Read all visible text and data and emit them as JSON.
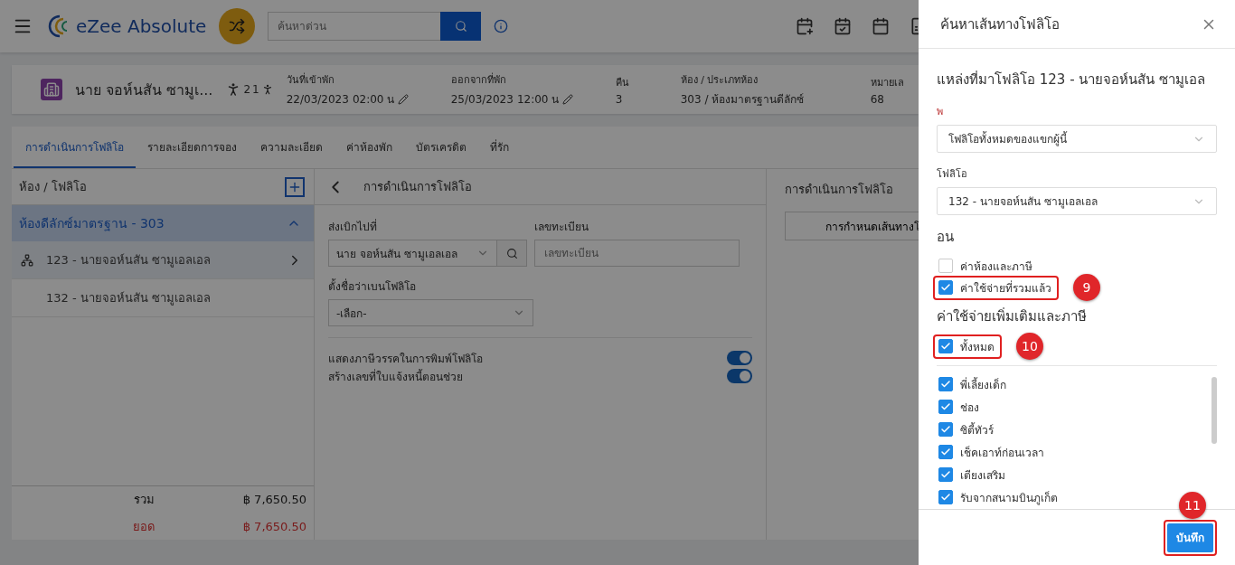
{
  "topbar": {
    "logo": "eZee Absolute",
    "search": {
      "placeholder": "ค้นหาด่วน"
    }
  },
  "guest": {
    "name": "นาย จอห์นสัน ซามูเ...",
    "adults": "2",
    "children": "1",
    "fields": [
      {
        "label": "วันที่เข้าพัก",
        "value": "22/03/2023",
        "time": "02:00 น",
        "editable": true
      },
      {
        "label": "ออกจากที่พัก",
        "value": "25/03/2023",
        "time": "12:00 น",
        "editable": true
      },
      {
        "label": "คืน",
        "value": "3",
        "editable": false
      },
      {
        "label": "ห้อง / ประเภทห้อง",
        "value": "303 / ห้องมาตรฐานดีลักซ์",
        "editable": false
      },
      {
        "label": "หมายเล",
        "value": "68",
        "editable": false
      }
    ]
  },
  "tabs": [
    {
      "label": "การดำเนินการโฟลิโอ",
      "selected": true
    },
    {
      "label": "รายละเอียดการจอง",
      "selected": false
    },
    {
      "label": "ความละเอียด",
      "selected": false
    },
    {
      "label": "ค่าห้องพัก",
      "selected": false
    },
    {
      "label": "บัตรเครดิต",
      "selected": false
    },
    {
      "label": "ที่รัก",
      "selected": false
    }
  ],
  "folio_list": {
    "title": "ห้อง / โฟลิโอ",
    "group": {
      "label": "ห้องดีลักซ์มาตรฐาน - 303",
      "expanded": true
    },
    "items": [
      {
        "label": "123 - นายจอห์นสัน ซามูเอลเอล",
        "selected": true
      },
      {
        "label": "132 - นายจอห์นสัน ซามูเอลเอล",
        "selected": false
      }
    ],
    "totals": [
      {
        "label": "รวม",
        "value": "฿ 7,650.50",
        "kind": "total"
      },
      {
        "label": "ยอด",
        "value": "฿ 7,650.50",
        "kind": "balance"
      }
    ]
  },
  "operations": {
    "title": "การดำเนินการโฟลิโอ",
    "send_to": {
      "label": "ส่งเบิกไปที่",
      "value": "นาย จอห์นสัน ซามูเอลเอล"
    },
    "registration": {
      "label": "เลขทะเบียน",
      "placeholder": "เลขทะเบียน"
    },
    "folio_name": {
      "label": "ตั้งชื่อว่าเบนโฟลิโอ",
      "value": "-เลือก-"
    },
    "toggles": [
      {
        "label": "แสดงภาษีวรรคในการพิมพ์โฟลิโอ",
        "on": true
      },
      {
        "label": "สร้างเลขที่ใบแจ้งหนี้ตอนช่วย",
        "on": true
      }
    ]
  },
  "side_panel": {
    "title": "การดำเนินการโฟลิโอ",
    "button": "การกำหนดเส้นทางโ"
  },
  "drawer": {
    "title": "ค้นหาเส้นทางโฟลิโอ",
    "heading": "แหล่งที่มาโฟลิโอ 123 - นายจอห์นสัน ซามูเอล",
    "selects": [
      {
        "label": "พ",
        "value": "โฟลิโอทั้งหมดของแขกผู้นี้"
      },
      {
        "label": "โฟลิโอ",
        "value": "132 - นายจอห์นสัน ซามูเอลเอล"
      }
    ],
    "section": "อน",
    "options": [
      {
        "label": "ค่าห้องและภาษี",
        "checked": false
      },
      {
        "label": "ค่าใช้จ่ายที่รวมแล้ว",
        "checked": true,
        "marker": "9"
      }
    ],
    "extras_title": "ค่าใช้จ่ายเพิ่มเติมและภาษี",
    "all": {
      "label": "ทั้งหมด",
      "checked": true,
      "marker": "10"
    },
    "extras": [
      {
        "label": "พี่เลี้ยงเด็ก",
        "checked": true
      },
      {
        "label": "ช่อง",
        "checked": true
      },
      {
        "label": "ซิตี้ทัวร์",
        "checked": true
      },
      {
        "label": "เช็คเอาท์ก่อนเวลา",
        "checked": true
      },
      {
        "label": "เตียงเสริม",
        "checked": true
      },
      {
        "label": "รับจากสนามบินภูเก็ต",
        "checked": true
      }
    ],
    "save": {
      "label": "บันทึก",
      "marker": "11"
    }
  }
}
